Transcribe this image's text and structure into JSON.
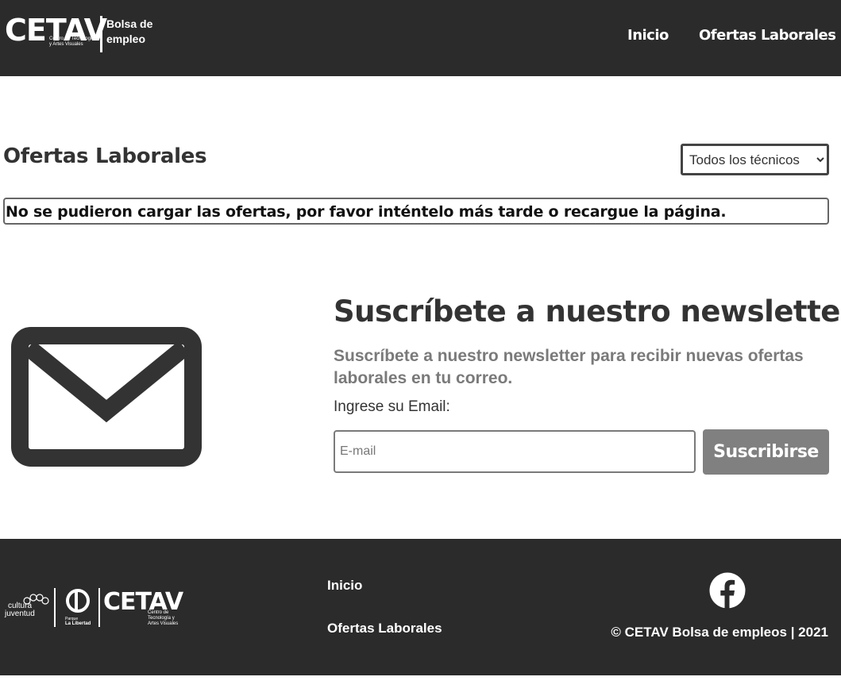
{
  "header": {
    "logo_text": "CETAV",
    "logo_subtitle": "Centro de Tecnología y Artes Visuales",
    "logo_tagline": "Bolsa de empleo",
    "nav": [
      {
        "label": "Inicio"
      },
      {
        "label": "Ofertas Laborales"
      }
    ]
  },
  "main": {
    "title": "Ofertas Laborales",
    "filter": {
      "selected": "Todos los técnicos",
      "options": [
        "Todos los técnicos"
      ]
    },
    "error_message": "No se pudieron cargar las ofertas, por favor inténtelo más tarde o recargue la página."
  },
  "newsletter": {
    "icon": "envelope-icon",
    "title": "Suscríbete a nuestro newsletter",
    "description": "Suscríbete a nuestro newsletter para recibir nuevas ofertas laborales en tu correo.",
    "email_label": "Ingrese su Email:",
    "email_placeholder": "E-mail",
    "email_value": "",
    "button_label": "Suscribirse"
  },
  "footer": {
    "logos": {
      "cultura_line1": "cultura",
      "cultura_line2": "juventud",
      "parque_line1": "Parque",
      "parque_line2": "La Libertad",
      "cetav": "CETAV",
      "cetav_subtitle": "Centro de Tecnología y Artes Visuales"
    },
    "links": [
      {
        "label": "Inicio"
      },
      {
        "label": "Ofertas Laborales"
      }
    ],
    "social_icon": "facebook-icon",
    "copyright": "© CETAV Bolsa de empleos | 2021"
  },
  "colors": {
    "header_bg": "#2b2b2b",
    "footer_bg": "#2b2b2b",
    "button_bg": "#808080",
    "text_dark": "#333333",
    "text_muted": "#7a7a7a"
  }
}
